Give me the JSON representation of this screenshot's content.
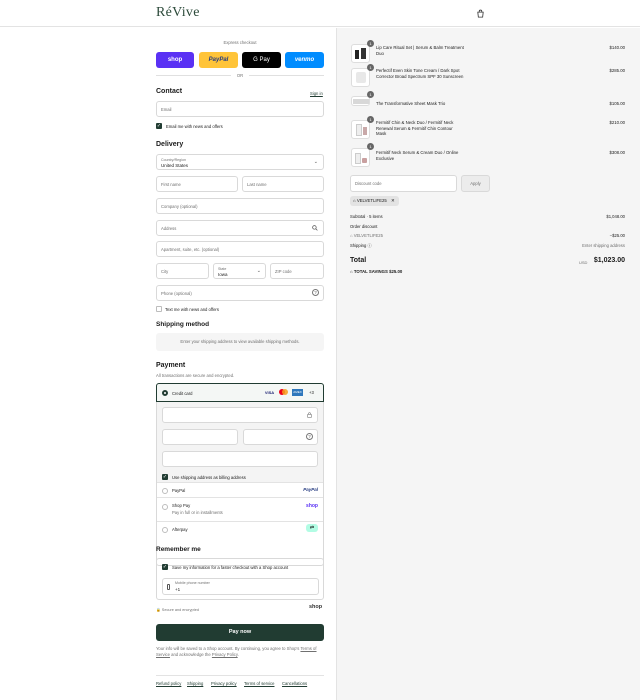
{
  "brand": {
    "logo": "RéVive"
  },
  "express": {
    "title": "Express checkout",
    "buttons": [
      {
        "label": "shop",
        "color": "#5a31f4"
      },
      {
        "label": "PayPal",
        "color": "#ffc439"
      },
      {
        "label": "G Pay",
        "color": "#000000"
      },
      {
        "label": "venmo",
        "color": "#008cff"
      }
    ],
    "or": "OR"
  },
  "contact": {
    "title": "Contact",
    "sign_in": "Sign in",
    "email_placeholder": "Email",
    "news_label": "Email me with news and offers"
  },
  "delivery": {
    "title": "Delivery",
    "country_label": "Country/Region",
    "country_value": "United States",
    "first_name": "First name",
    "last_name": "Last name",
    "company": "Company (optional)",
    "address": "Address",
    "apartment": "Apartment, suite, etc. (optional)",
    "city": "City",
    "state_label": "State",
    "state_value": "Iowa",
    "zip": "ZIP code",
    "phone": "Phone (optional)",
    "text_offers": "Text me with news and offers"
  },
  "shipping": {
    "title": "Shipping method",
    "message": "Enter your shipping address to view available shipping methods."
  },
  "payment": {
    "title": "Payment",
    "subtitle": "All transactions are secure and encrypted.",
    "credit_card": "Credit card",
    "card_more": "+3",
    "billing_label": "Use shipping address as billing address",
    "paypal": "PayPal",
    "paypal_logo": "PayPal",
    "shop_pay": "Shop Pay",
    "shop_pay_sub": "Pay in full or in installments",
    "shop_pay_logo": "shop",
    "afterpay": "Afterpay"
  },
  "remember": {
    "title": "Remember me",
    "save_label": "Save my information for a faster checkout with a Shop account",
    "mobile_label": "Mobile phone number",
    "mobile_value": "+1",
    "secure": "Secure and encrypted",
    "shop_logo": "shop"
  },
  "pay_now": "Pay now",
  "legal": {
    "text": "Your info will be saved to a Shop account. By continuing, you agree to Shop's",
    "terms": "Terms of Service",
    "and": "and acknowledge the",
    "privacy": "Privacy Policy",
    "end": "."
  },
  "footer_links": [
    "Refund policy",
    "Shipping",
    "Privacy policy",
    "Terms of service",
    "Cancellations"
  ],
  "summary": {
    "products": [
      {
        "qty": "1",
        "name": "Lip Care Ritual Set | Serum & Balm Treatment Duo",
        "price": "$140.00"
      },
      {
        "qty": "1",
        "name": "Perfectif Even Skin Tone Cream / Dark Spot Corrector Broad Spectrum SPF 30 Sunscreen",
        "price": "$285.00"
      },
      {
        "qty": "1",
        "name": "The Transformative Sheet Mask Trio",
        "price": "$105.00"
      },
      {
        "qty": "1",
        "name": "Fermitif Chin & Neck Duo / Fermitif Neck Renewal Serum & Fermitif Chin Contour Mask",
        "price": "$210.00"
      },
      {
        "qty": "1",
        "name": "Fermitif Neck Serum & Cream Duo / Online Exclusive",
        "price": "$308.00"
      }
    ],
    "discount_placeholder": "Discount code",
    "apply": "Apply",
    "code_tag": "VELVETLIFE25",
    "subtotal_label": "Subtotal · 5 items",
    "subtotal_value": "$1,048.00",
    "order_discount": "Order discount",
    "discount_code": "VELVETLIFE25",
    "discount_value": "−$25.00",
    "shipping_label": "Shipping",
    "shipping_value": "Enter shipping address",
    "total_label": "Total",
    "currency": "USD",
    "total_value": "$1,023.00",
    "savings_label": "TOTAL SAVINGS",
    "savings_value": "$25.00"
  },
  "colors": {
    "primary": "#213c32",
    "logo": "#2c4a3a",
    "sidebar_bg": "#f5f5f5"
  }
}
